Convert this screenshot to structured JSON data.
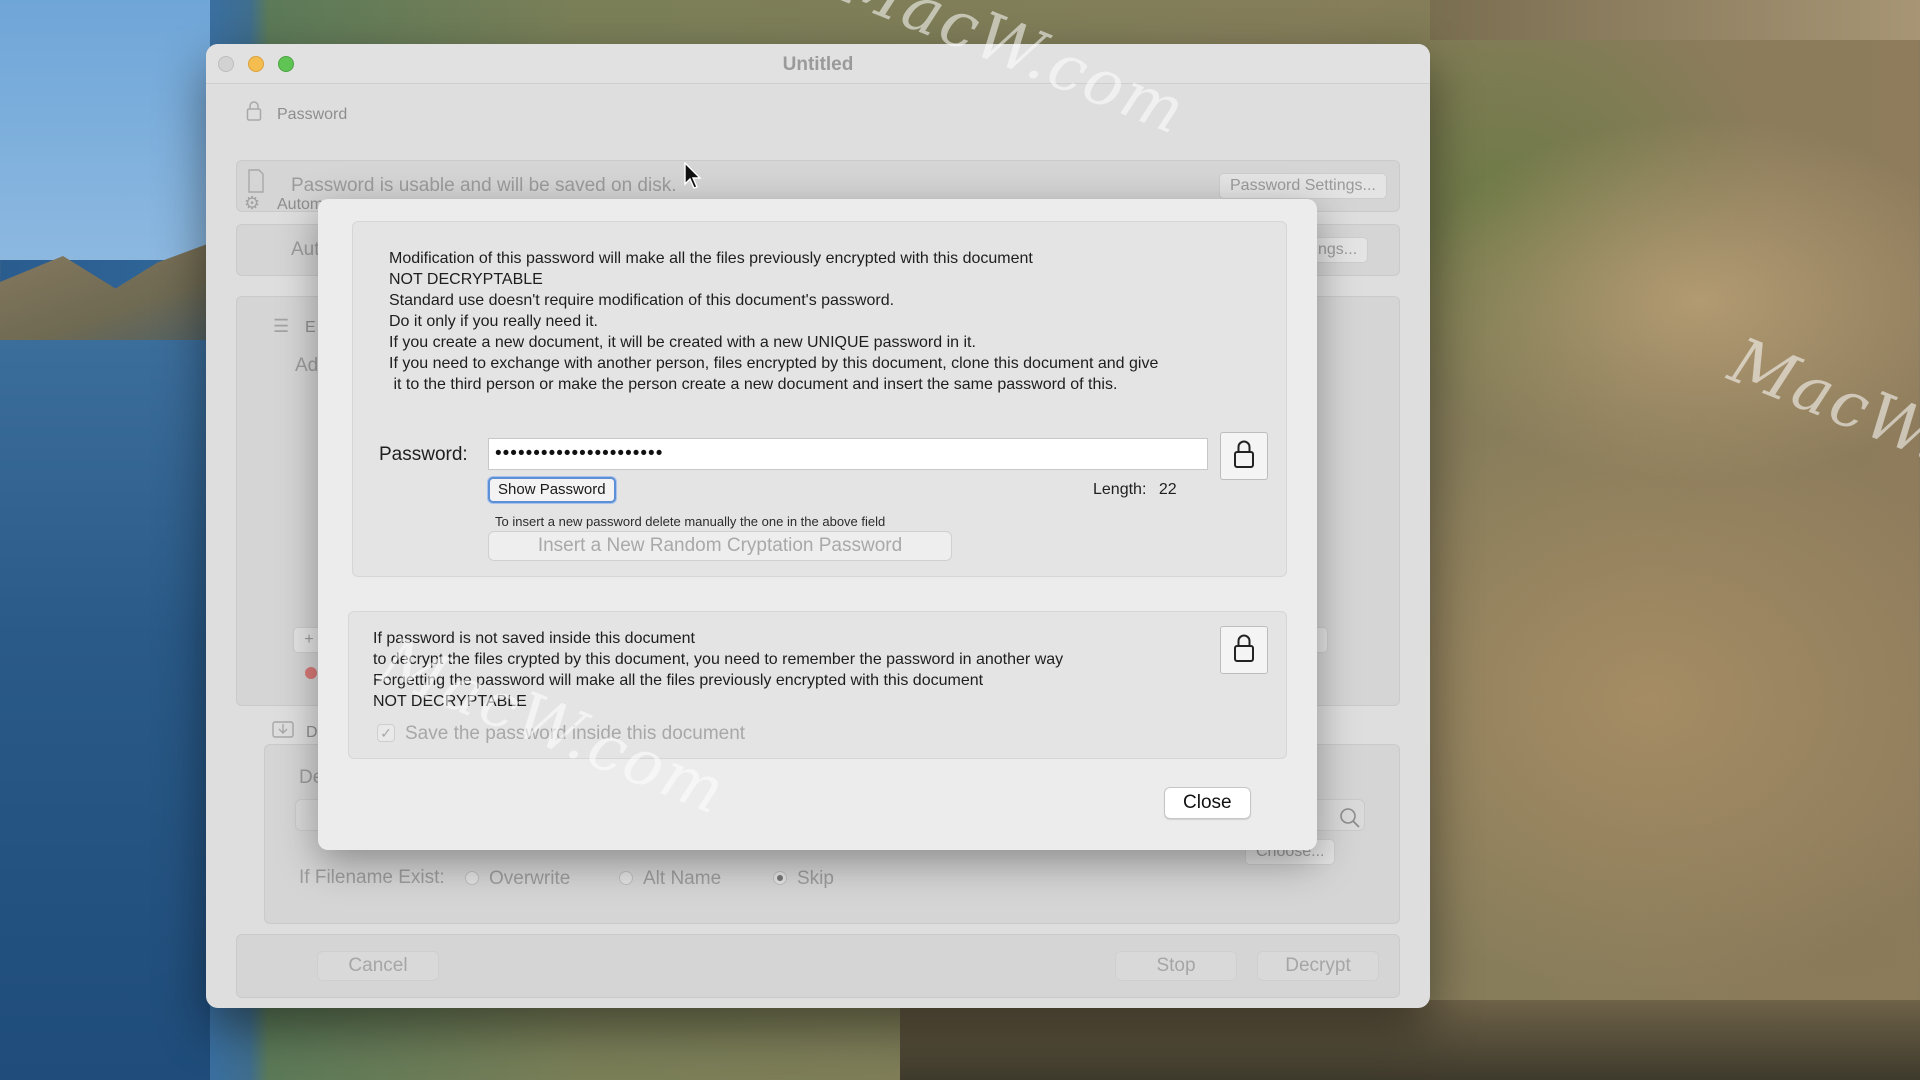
{
  "window": {
    "title": "Untitled"
  },
  "background_window": {
    "password_section": {
      "label": "Password",
      "status_text": "Password is usable and will be saved on disk.",
      "settings_button": "Password Settings..."
    },
    "auto_section": {
      "label_partial": "Autom",
      "row_partial": "Aut",
      "settings_button_partial": "ngs..."
    },
    "encrypt_section": {
      "label_partial": "E",
      "row_partial": "Ad",
      "add_button": "+",
      "right_button_partial": "d"
    },
    "decrypt_section": {
      "label_partial": "D",
      "row_partial": "De",
      "choose_button_partial": "Choose...",
      "if_filename_exist_label": "If Filename Exist:",
      "options": [
        "Overwrite",
        "Alt Name",
        "Skip"
      ],
      "selected_option": "Skip"
    },
    "buttons": {
      "cancel": "Cancel",
      "stop": "Stop",
      "decrypt": "Decrypt"
    }
  },
  "dialog": {
    "warning_lines": [
      "Modification of this password will make all the files previously encrypted with this document",
      "NOT DECRYPTABLE",
      "Standard use doesn't require modification of this document's password.",
      "Do it only if you really need it.",
      "If you create a new document, it will be created with a new UNIQUE password in it.",
      "If you need to exchange with another person, files encrypted by this document, clone this document and give",
      " it to the third person or make the person create a new document and insert the same password of this."
    ],
    "password_label": "Password:",
    "password_value": "••••••••••••••••••••••",
    "show_password_button": "Show Password",
    "length_label": "Length:",
    "length_value": "22",
    "hint": "To insert a new password delete manually the one in the above field",
    "random_button": "Insert a New Random Cryptation Password",
    "save_info_lines": [
      "If password is not saved inside this document",
      "to decrypt the files crypted by this document, you need to remember the password in another way",
      "Forgetting the password will make all the files previously encrypted with this document",
      "NOT DECRYPTABLE"
    ],
    "save_checkbox_label": "Save the password inside this document",
    "save_checkbox_checked": true,
    "close_button": "Close"
  },
  "watermark": {
    "text": "MacW.com"
  },
  "icons": {
    "lock": "lock-icon",
    "document": "document-icon",
    "gear": "gear-icon",
    "list": "list-icon",
    "download": "download-icon",
    "search": "search-icon",
    "cursor": "cursor-arrow"
  }
}
